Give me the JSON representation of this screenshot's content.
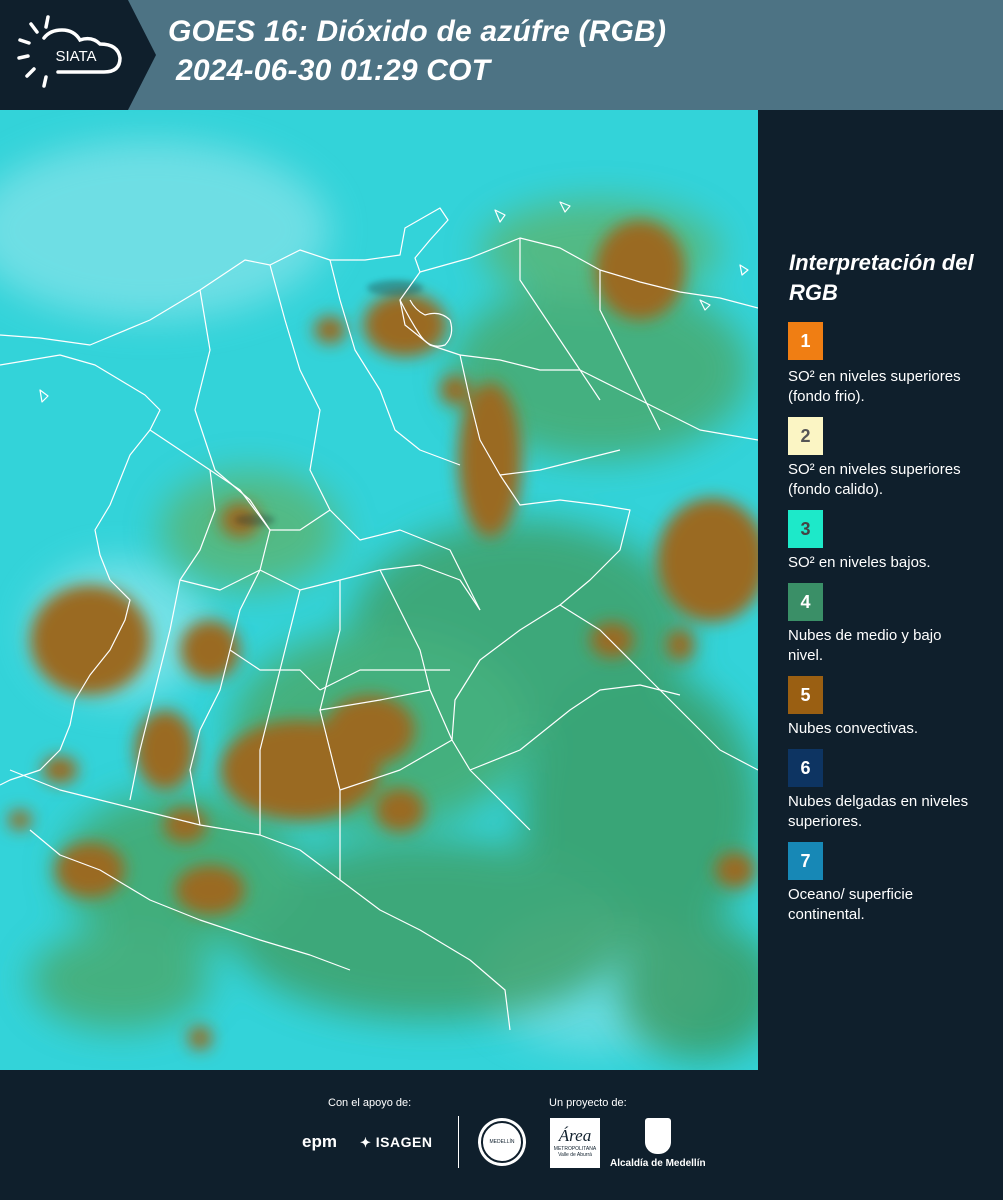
{
  "header": {
    "logo_text": "SIATA",
    "title_line1": "GOES 16: Dióxido de azúfre (RGB)",
    "title_line2": "2024-06-30 01:29 COT"
  },
  "legend": {
    "title": "Interpretación del RGB",
    "items": [
      {
        "num": "1",
        "color": "#f07e13",
        "num_color": "#ffffff",
        "text": "SO² en niveles superiores (fondo frio)."
      },
      {
        "num": "2",
        "color": "#fbf5c4",
        "num_color": "#555555",
        "text": "SO² en niveles superiores (fondo calido)."
      },
      {
        "num": "3",
        "color": "#1de9c9",
        "num_color": "#444444",
        "text": "SO² en niveles bajos."
      },
      {
        "num": "4",
        "color": "#3a8f67",
        "num_color": "#ffffff",
        "text": "Nubes de medio y bajo nivel."
      },
      {
        "num": "5",
        "color": "#9a5f12",
        "num_color": "#ffffff",
        "text": "Nubes convectivas."
      },
      {
        "num": "6",
        "color": "#0d3462",
        "num_color": "#ffffff",
        "text": "Nubes delgadas en niveles superiores."
      },
      {
        "num": "7",
        "color": "#1788b6",
        "num_color": "#ffffff",
        "text": "Oceano/ superficie continental."
      }
    ]
  },
  "footer": {
    "support_label": "Con el apoyo de:",
    "project_label": "Un proyecto de:",
    "sponsor1": "epm",
    "sponsor2": "ISAGEN",
    "partner1_seal": "MEDELLÍN",
    "partner2_name": "Área",
    "partner2_sub1": "METROPOLITANA",
    "partner2_sub2": "Valle de Aburrá",
    "partner3": "Alcaldía de Medellín"
  },
  "map": {
    "ocean_color": "#2fd0d6",
    "land_green": "#3f9e63",
    "convective_color": "#9a6a22",
    "border_color": "#ffffff"
  }
}
